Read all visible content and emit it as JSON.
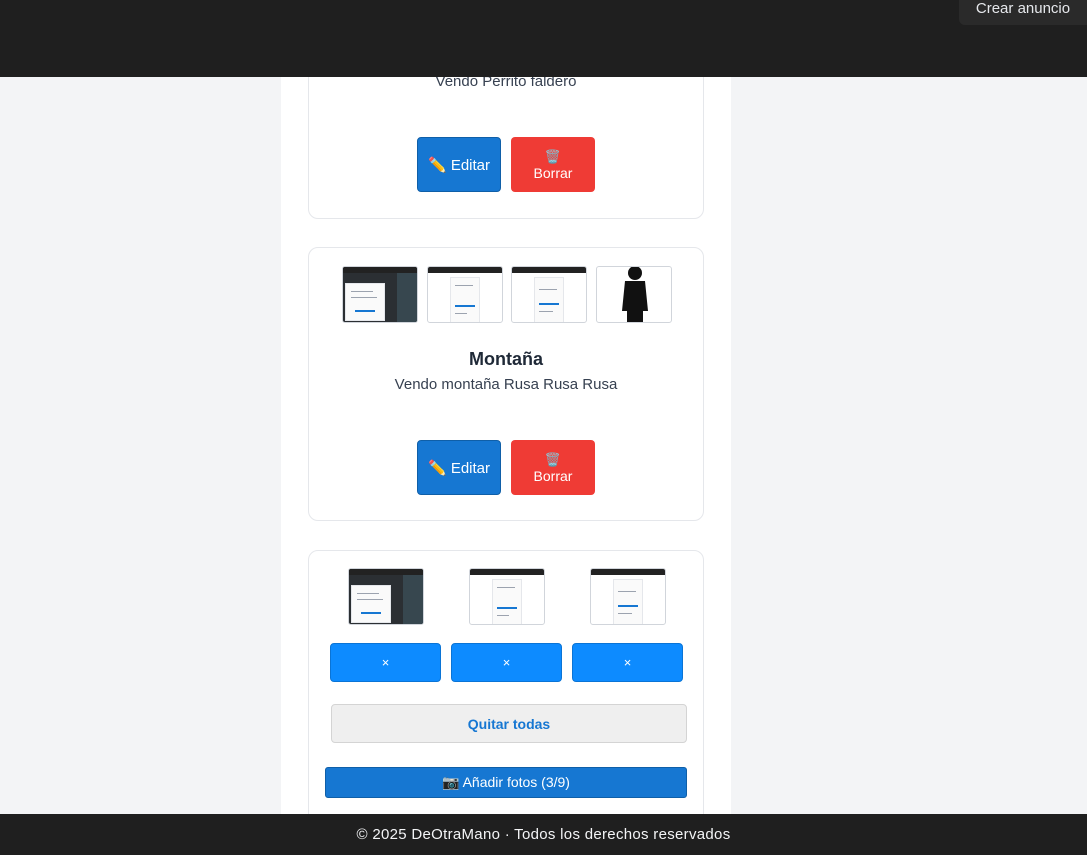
{
  "header": {
    "create_ad_label": "Crear anuncio"
  },
  "listings": [
    {
      "title": "",
      "description": "Vendo Perrito faldero",
      "edit_label": "✏️ Editar",
      "delete_icon": "🗑️",
      "delete_label": "Borrar"
    },
    {
      "title": "Montaña",
      "description": "Vendo montaña Rusa Rusa Rusa",
      "edit_label": "✏️ Editar",
      "delete_icon": "🗑️",
      "delete_label": "Borrar"
    }
  ],
  "upload": {
    "remove_labels": [
      "×",
      "×",
      "×"
    ],
    "remove_all_label": "Quitar todas",
    "add_photos_label": "📷 Añadir fotos (3/9)"
  },
  "footer": {
    "text": "© 2025 DeOtraMano · Todos los derechos reservados"
  },
  "colors": {
    "header_bg": "#1f1f1f",
    "edit_button": "#1677d2",
    "delete_button": "#ef3b35",
    "remove_button": "#0d8bff"
  }
}
